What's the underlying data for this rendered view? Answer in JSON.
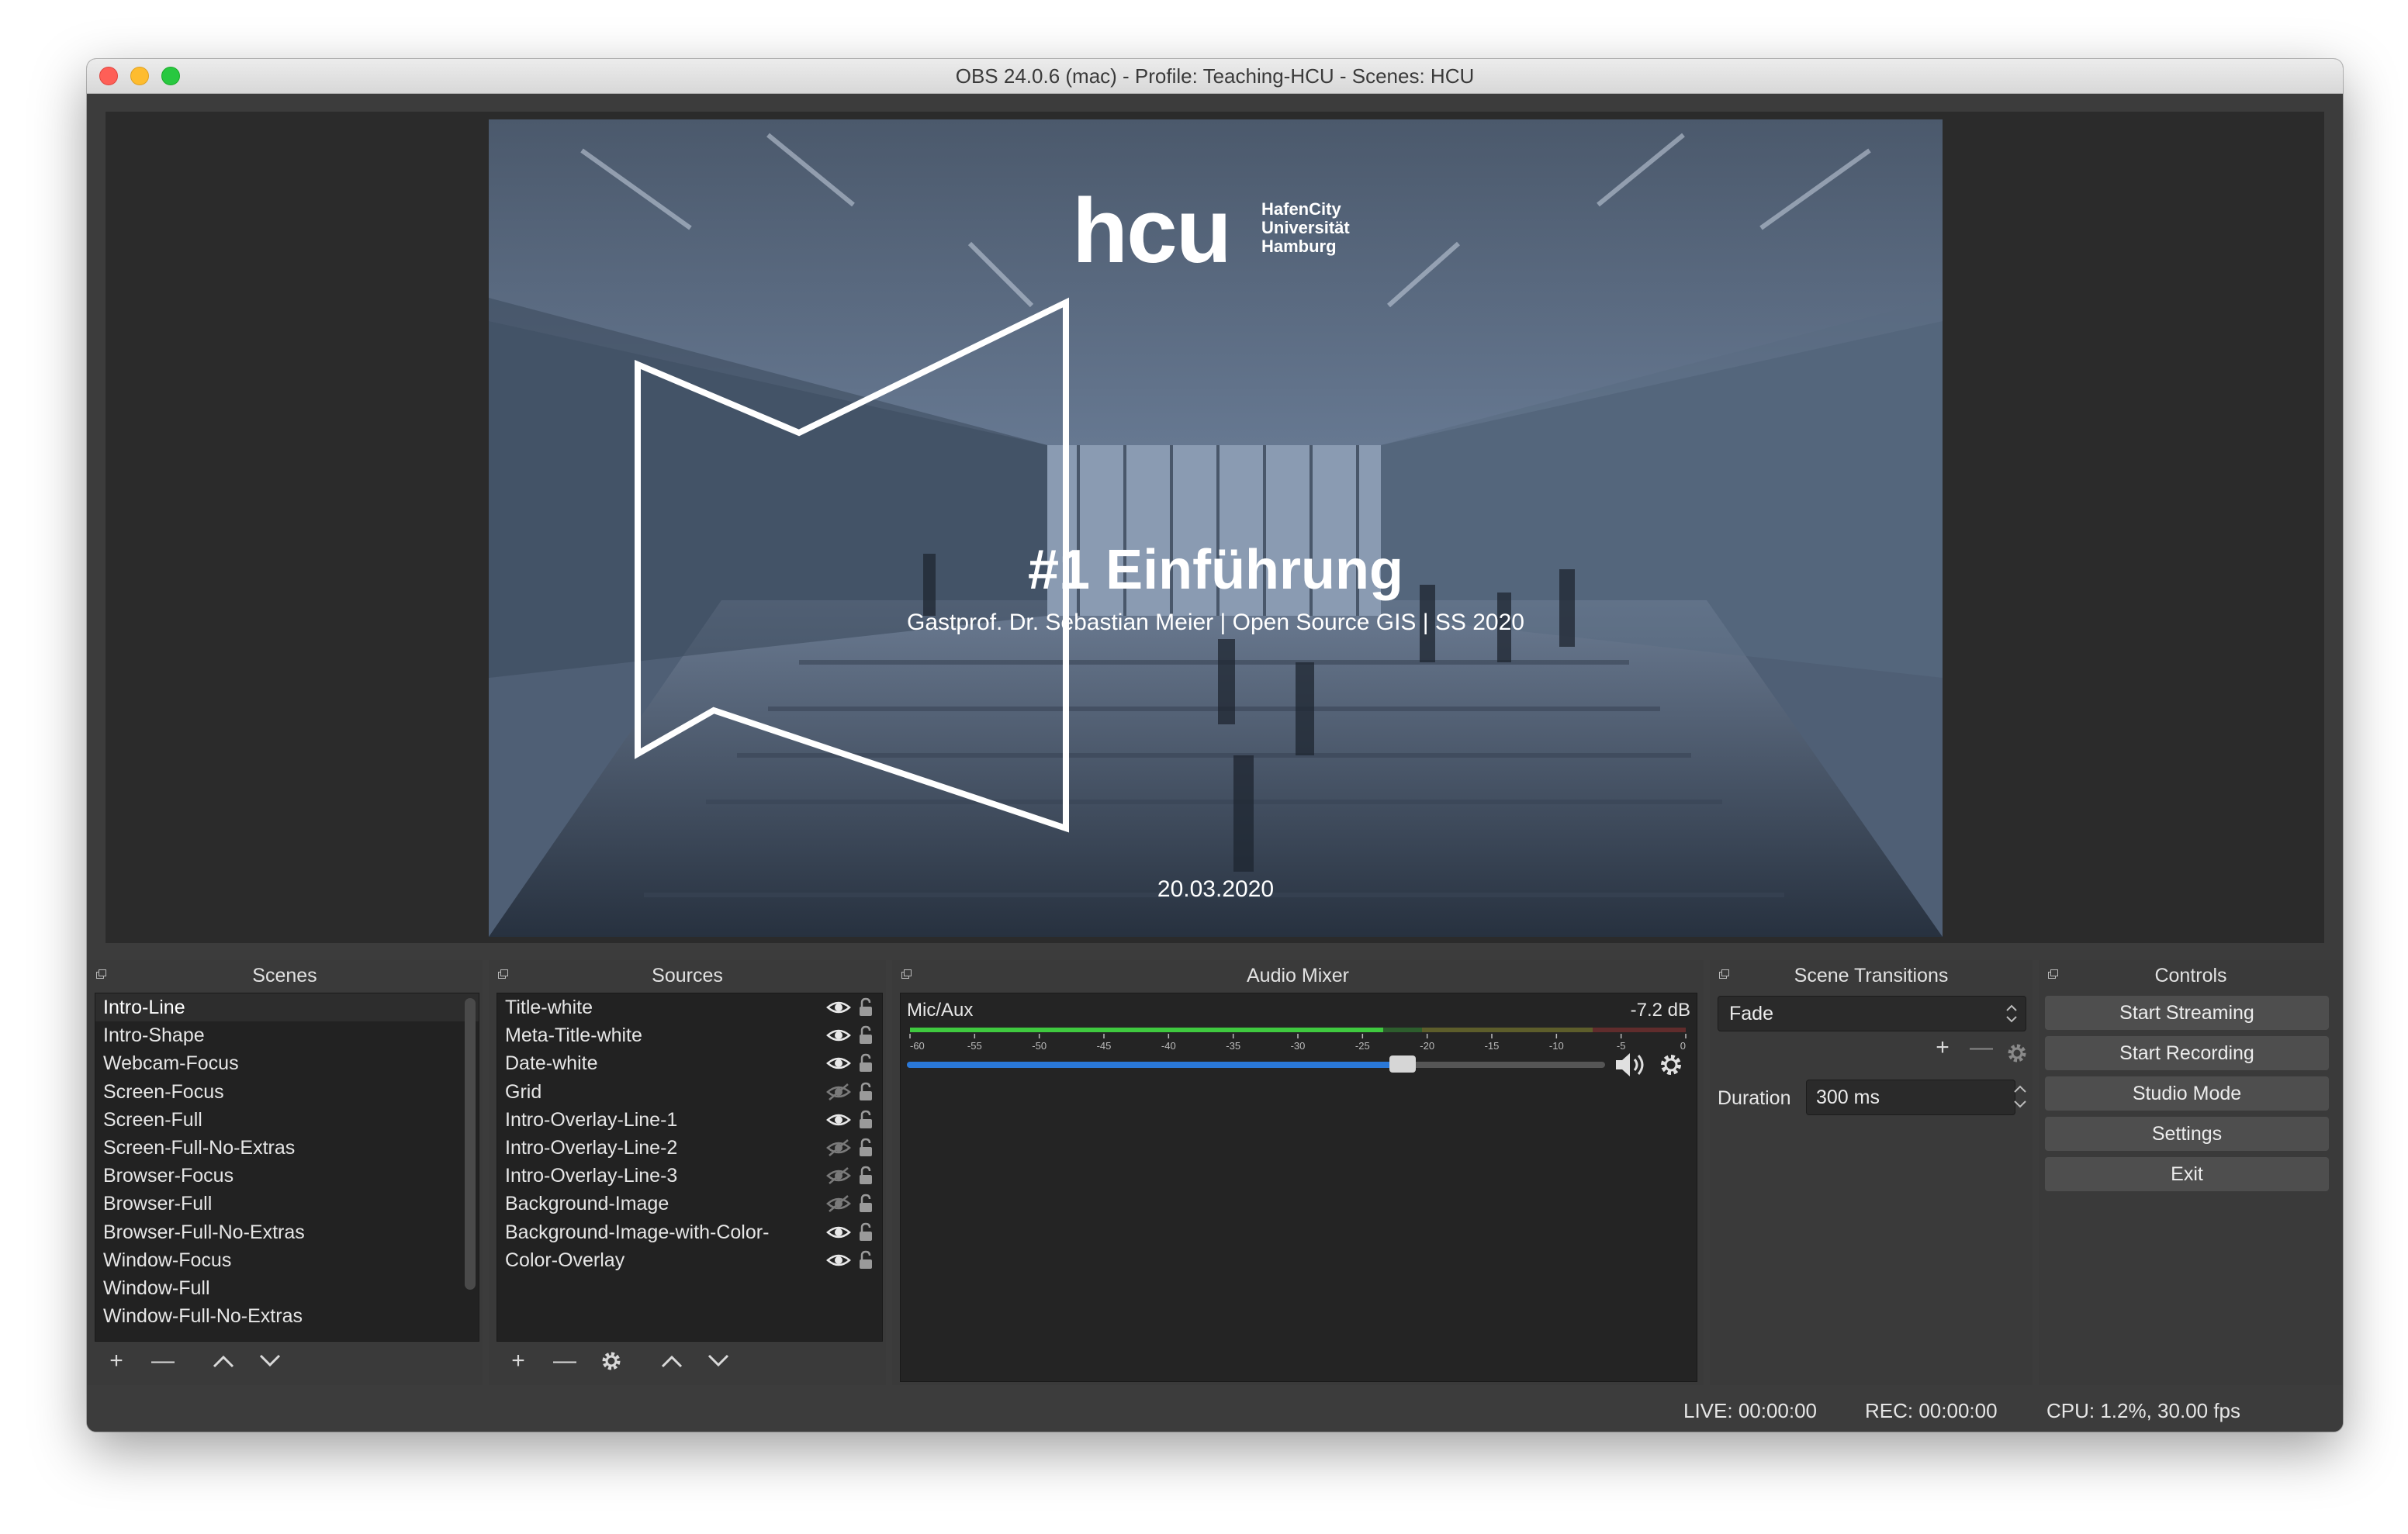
{
  "window": {
    "title": "OBS 24.0.6 (mac) - Profile: Teaching-HCU - Scenes: HCU"
  },
  "preview": {
    "logo": "hcu",
    "logo_subtitle": [
      "HafenCity",
      "Universität",
      "Hamburg"
    ],
    "title": "#1 Einführung",
    "subtitle": "Gastprof. Dr. Sebastian Meier | Open Source GIS | SS 2020",
    "date": "20.03.2020"
  },
  "scenes": {
    "header": "Scenes",
    "items": [
      "Intro-Line",
      "Intro-Shape",
      "Webcam-Focus",
      "Screen-Focus",
      "Screen-Full",
      "Screen-Full-No-Extras",
      "Browser-Focus",
      "Browser-Full",
      "Browser-Full-No-Extras",
      "Window-Focus",
      "Window-Full",
      "Window-Full-No-Extras"
    ],
    "selected_index": 0
  },
  "sources": {
    "header": "Sources",
    "items": [
      {
        "name": "Title-white",
        "visible": true
      },
      {
        "name": "Meta-Title-white",
        "visible": true
      },
      {
        "name": "Date-white",
        "visible": true
      },
      {
        "name": "Grid",
        "visible": false
      },
      {
        "name": "Intro-Overlay-Line-1",
        "visible": true
      },
      {
        "name": "Intro-Overlay-Line-2",
        "visible": false
      },
      {
        "name": "Intro-Overlay-Line-3",
        "visible": false
      },
      {
        "name": "Background-Image",
        "visible": false
      },
      {
        "name": "Background-Image-with-Color-",
        "visible": true
      },
      {
        "name": "Color-Overlay",
        "visible": true
      }
    ]
  },
  "mixer": {
    "header": "Audio Mixer",
    "channel": "Mic/Aux",
    "level": "-7.2 dB",
    "scale": [
      "-60",
      "-55",
      "-50",
      "-45",
      "-40",
      "-35",
      "-30",
      "-25",
      "-20",
      "-15",
      "-10",
      "-5",
      "0"
    ],
    "volume_fraction": 0.71,
    "meter_fraction": 0.61
  },
  "transitions": {
    "header": "Scene Transitions",
    "selected": "Fade",
    "duration_label": "Duration",
    "duration_value": "300 ms"
  },
  "controls": {
    "header": "Controls",
    "start_streaming": "Start Streaming",
    "start_recording": "Start Recording",
    "studio_mode": "Studio Mode",
    "settings": "Settings",
    "exit": "Exit"
  },
  "status": {
    "live": "LIVE: 00:00:00",
    "rec": "REC: 00:00:00",
    "cpu": "CPU: 1.2%, 30.00 fps"
  },
  "colors": {
    "meter_green": "#3fc93f",
    "meter_yellow": "#c8c83a",
    "meter_red": "#d23b3b",
    "volume_blue": "#2a78d8",
    "panel_bg": "#3a3a3a"
  }
}
